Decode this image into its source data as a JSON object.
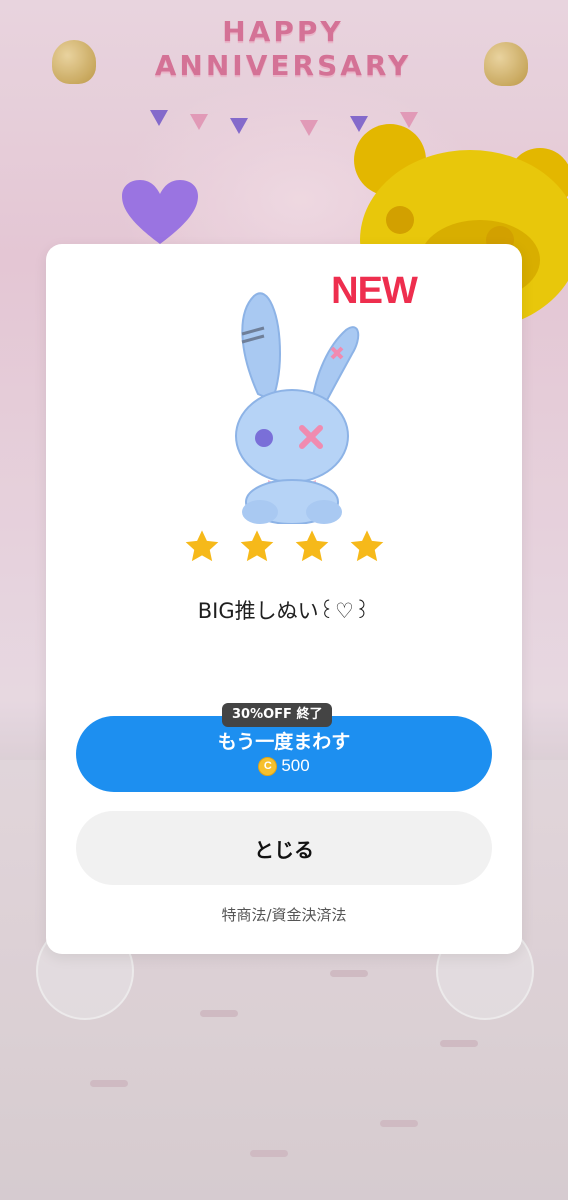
{
  "background": {
    "banner_text": "HAPPY ANNIVERSARY"
  },
  "modal": {
    "badge": "NEW",
    "item_icon": "bunny-plush-icon",
    "rating": 4,
    "item_name": "BIG推しぬい꒰♡꒱",
    "discount_tag": "30%OFF 終了",
    "spin_again_label": "もう一度まわす",
    "coin_icon": "coin-icon",
    "coin_symbol": "C",
    "cost": "500",
    "close_label": "とじる",
    "legal_link": "特商法/資金決済法"
  },
  "colors": {
    "primary": "#1d8ff0",
    "star": "#f6b91a",
    "new_badge": "#ee2e4e"
  }
}
